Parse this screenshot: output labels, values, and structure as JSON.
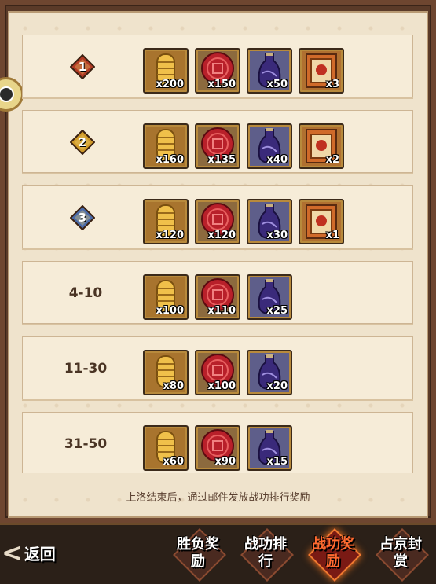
{
  "rows": [
    {
      "rank_badge": "1",
      "rank_label": "",
      "badge_color": "#b03a24",
      "items": [
        {
          "type": "gold-ingot",
          "qty": "x200"
        },
        {
          "type": "red-seal",
          "qty": "x150"
        },
        {
          "type": "sake-jar",
          "qty": "x50"
        },
        {
          "type": "card-pack",
          "qty": "x3"
        }
      ]
    },
    {
      "rank_badge": "2",
      "rank_label": "",
      "badge_color": "#d09a2a",
      "items": [
        {
          "type": "gold-ingot",
          "qty": "x160"
        },
        {
          "type": "red-seal",
          "qty": "x135"
        },
        {
          "type": "sake-jar",
          "qty": "x40"
        },
        {
          "type": "card-pack",
          "qty": "x2"
        }
      ]
    },
    {
      "rank_badge": "3",
      "rank_label": "",
      "badge_color": "#4a6aa8",
      "items": [
        {
          "type": "gold-ingot",
          "qty": "x120"
        },
        {
          "type": "red-seal",
          "qty": "x120"
        },
        {
          "type": "sake-jar",
          "qty": "x30"
        },
        {
          "type": "card-pack",
          "qty": "x1"
        }
      ]
    },
    {
      "rank_badge": "",
      "rank_label": "4-10",
      "items": [
        {
          "type": "gold-ingot",
          "qty": "x100"
        },
        {
          "type": "red-seal",
          "qty": "x110"
        },
        {
          "type": "sake-jar",
          "qty": "x25"
        }
      ]
    },
    {
      "rank_badge": "",
      "rank_label": "11-30",
      "items": [
        {
          "type": "gold-ingot",
          "qty": "x80"
        },
        {
          "type": "red-seal",
          "qty": "x100"
        },
        {
          "type": "sake-jar",
          "qty": "x20"
        }
      ]
    },
    {
      "rank_badge": "",
      "rank_label": "31-50",
      "items": [
        {
          "type": "gold-ingot",
          "qty": "x60"
        },
        {
          "type": "red-seal",
          "qty": "x90"
        },
        {
          "type": "sake-jar",
          "qty": "x15"
        }
      ]
    }
  ],
  "notice": "上洛结束后，通过邮件发放战功排行奖励",
  "back_label": "返回",
  "tabs": [
    {
      "label": "胜负奖励",
      "active": false
    },
    {
      "label": "战功排行",
      "active": false
    },
    {
      "label": "战功奖励",
      "active": true
    },
    {
      "label": "占京封赏",
      "active": false
    }
  ],
  "colors": {
    "active_tab": "#ff6a30",
    "paper": "#efe3cc",
    "row_bg": "#f6ecd8"
  }
}
